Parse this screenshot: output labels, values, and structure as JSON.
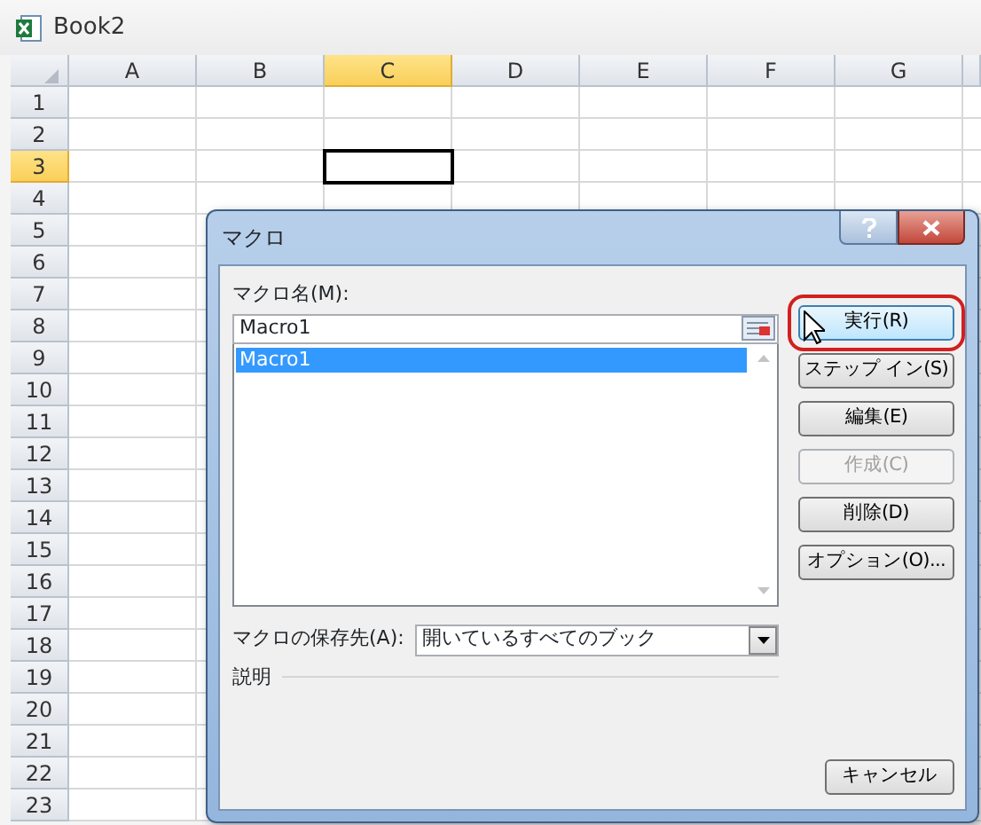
{
  "window": {
    "title": "Book2"
  },
  "sheet": {
    "columns": [
      {
        "label": "A",
        "selected": false
      },
      {
        "label": "B",
        "selected": false
      },
      {
        "label": "C",
        "selected": true
      },
      {
        "label": "D",
        "selected": false
      },
      {
        "label": "E",
        "selected": false
      },
      {
        "label": "F",
        "selected": false
      },
      {
        "label": "G",
        "selected": false
      }
    ],
    "rows": [
      {
        "label": "1",
        "selected": false
      },
      {
        "label": "2",
        "selected": false
      },
      {
        "label": "3",
        "selected": true
      },
      {
        "label": "4",
        "selected": false
      },
      {
        "label": "5",
        "selected": false
      },
      {
        "label": "6",
        "selected": false
      },
      {
        "label": "7",
        "selected": false
      },
      {
        "label": "8",
        "selected": false
      },
      {
        "label": "9",
        "selected": false
      },
      {
        "label": "10",
        "selected": false
      },
      {
        "label": "11",
        "selected": false
      },
      {
        "label": "12",
        "selected": false
      },
      {
        "label": "13",
        "selected": false
      },
      {
        "label": "14",
        "selected": false
      },
      {
        "label": "15",
        "selected": false
      },
      {
        "label": "16",
        "selected": false
      },
      {
        "label": "17",
        "selected": false
      },
      {
        "label": "18",
        "selected": false
      },
      {
        "label": "19",
        "selected": false
      },
      {
        "label": "20",
        "selected": false
      },
      {
        "label": "21",
        "selected": false
      },
      {
        "label": "22",
        "selected": false
      },
      {
        "label": "23",
        "selected": false
      }
    ]
  },
  "dialog": {
    "title": "マクロ",
    "macro_name_label": "マクロ名(M):",
    "macro_name_value": "Macro1",
    "macros": [
      {
        "label": "Macro1",
        "selected": true
      }
    ],
    "buttons": [
      {
        "label": "実行(R)",
        "disabled": false,
        "highlighted": true
      },
      {
        "label": "ステップ イン(S)",
        "disabled": false,
        "highlighted": false
      },
      {
        "label": "編集(E)",
        "disabled": false,
        "highlighted": false
      },
      {
        "label": "作成(C)",
        "disabled": true,
        "highlighted": false
      },
      {
        "label": "削除(D)",
        "disabled": false,
        "highlighted": false
      },
      {
        "label": "オプション(O)...",
        "disabled": false,
        "highlighted": false
      }
    ],
    "storage_label": "マクロの保存先(A):",
    "storage_value": "開いているすべてのブック",
    "description_label": "説明",
    "cancel_button": "キャンセル"
  }
}
